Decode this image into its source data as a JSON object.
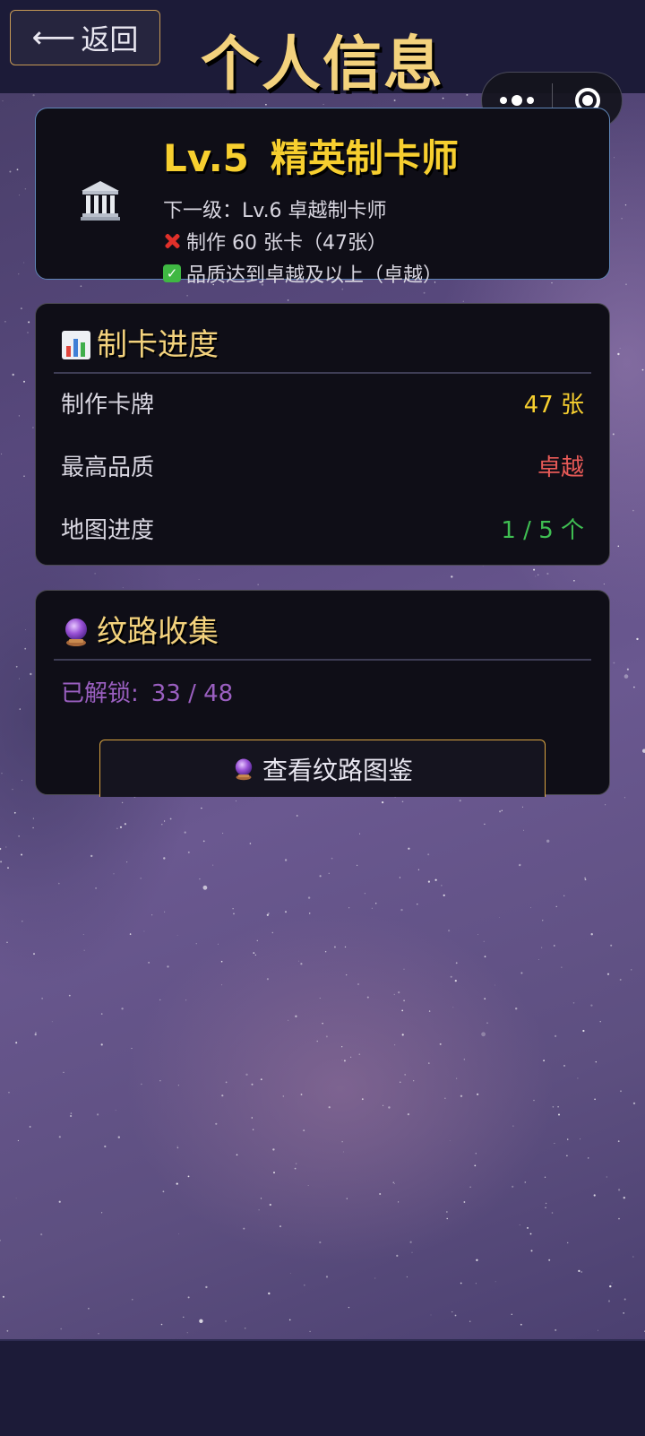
{
  "header": {
    "back_label": "返回",
    "title": "个人信息"
  },
  "capsule": {
    "more_icon": "more-dots-icon",
    "close_icon": "target-close-icon"
  },
  "level_card": {
    "icon": "classical-building-icon",
    "level": "Lv.5",
    "rank": "精英制卡师",
    "next_level": "下一级：Lv.6 卓越制卡师",
    "requirements": [
      {
        "status": "unmet",
        "icon": "cross-mark-icon",
        "text": "制作 60 张卡（47张）"
      },
      {
        "status": "met",
        "icon": "check-mark-icon",
        "text": "品质达到卓越及以上（卓越）"
      }
    ]
  },
  "progress_card": {
    "icon": "bar-chart-icon",
    "title": "制卡进度",
    "rows": [
      {
        "label": "制作卡牌",
        "value": "47 张"
      },
      {
        "label": "最高品质",
        "value": "卓越"
      },
      {
        "label": "地图进度",
        "value": "1 / 5 个"
      }
    ]
  },
  "collection_card": {
    "icon": "crystal-ball-icon",
    "title": "纹路收集",
    "unlocked_label": "已解锁:",
    "unlocked_value": "33 / 48",
    "button_label": "查看纹路图鉴"
  },
  "colors": {
    "gold_title": "#f3d27d",
    "level_yellow": "#f7cf2f",
    "red": "#e85a57",
    "green": "#3fbe52",
    "purple": "#9a5fc0",
    "card_bg": "#0f0e17",
    "bar_bg": "#1c1b38"
  }
}
